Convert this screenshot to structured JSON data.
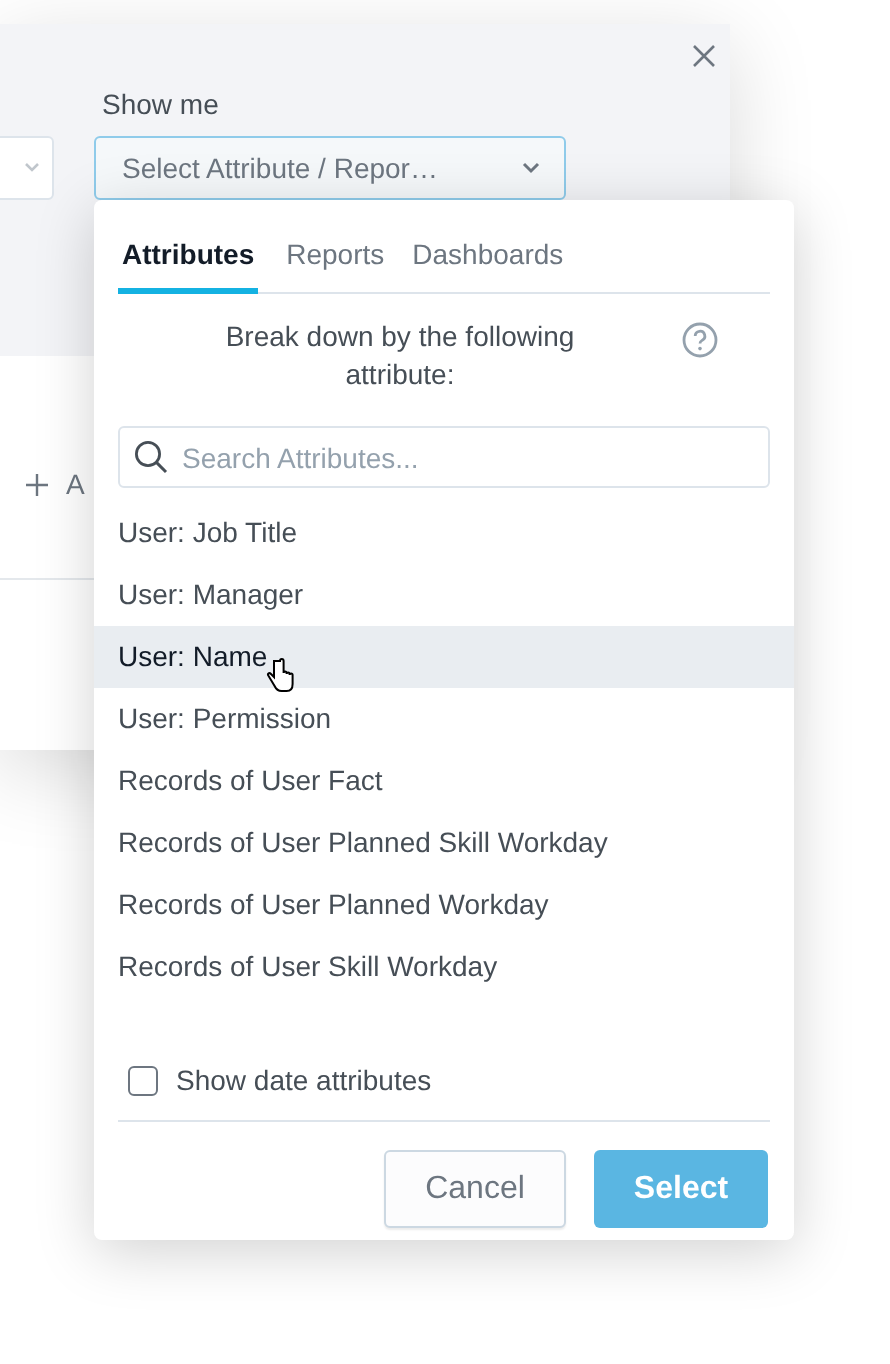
{
  "dialog": {
    "label": "Show me",
    "select_value": "Select Attribute / Repor…",
    "add_label": "A"
  },
  "dropdown": {
    "tabs": [
      {
        "label": "Attributes",
        "selected": true
      },
      {
        "label": "Reports",
        "selected": false
      },
      {
        "label": "Dashboards",
        "selected": false
      }
    ],
    "description": "Break down by the following attribute:",
    "search": {
      "placeholder": "Search Attributes..."
    },
    "items": [
      {
        "label": "User: Job Title",
        "hovered": false
      },
      {
        "label": "User: Manager",
        "hovered": false
      },
      {
        "label": "User: Name",
        "hovered": true
      },
      {
        "label": "User: Permission",
        "hovered": false
      },
      {
        "label": "Records of User Fact",
        "hovered": false
      },
      {
        "label": "Records of User Planned Skill Workday",
        "hovered": false
      },
      {
        "label": "Records of User Planned Workday",
        "hovered": false
      },
      {
        "label": "Records of User Skill Workday",
        "hovered": false
      }
    ],
    "show_date": {
      "label": "Show date attributes",
      "checked": false
    },
    "buttons": [
      {
        "label": "Cancel",
        "kind": "secondary"
      },
      {
        "label": "Select",
        "kind": "primary_disabled"
      }
    ]
  }
}
